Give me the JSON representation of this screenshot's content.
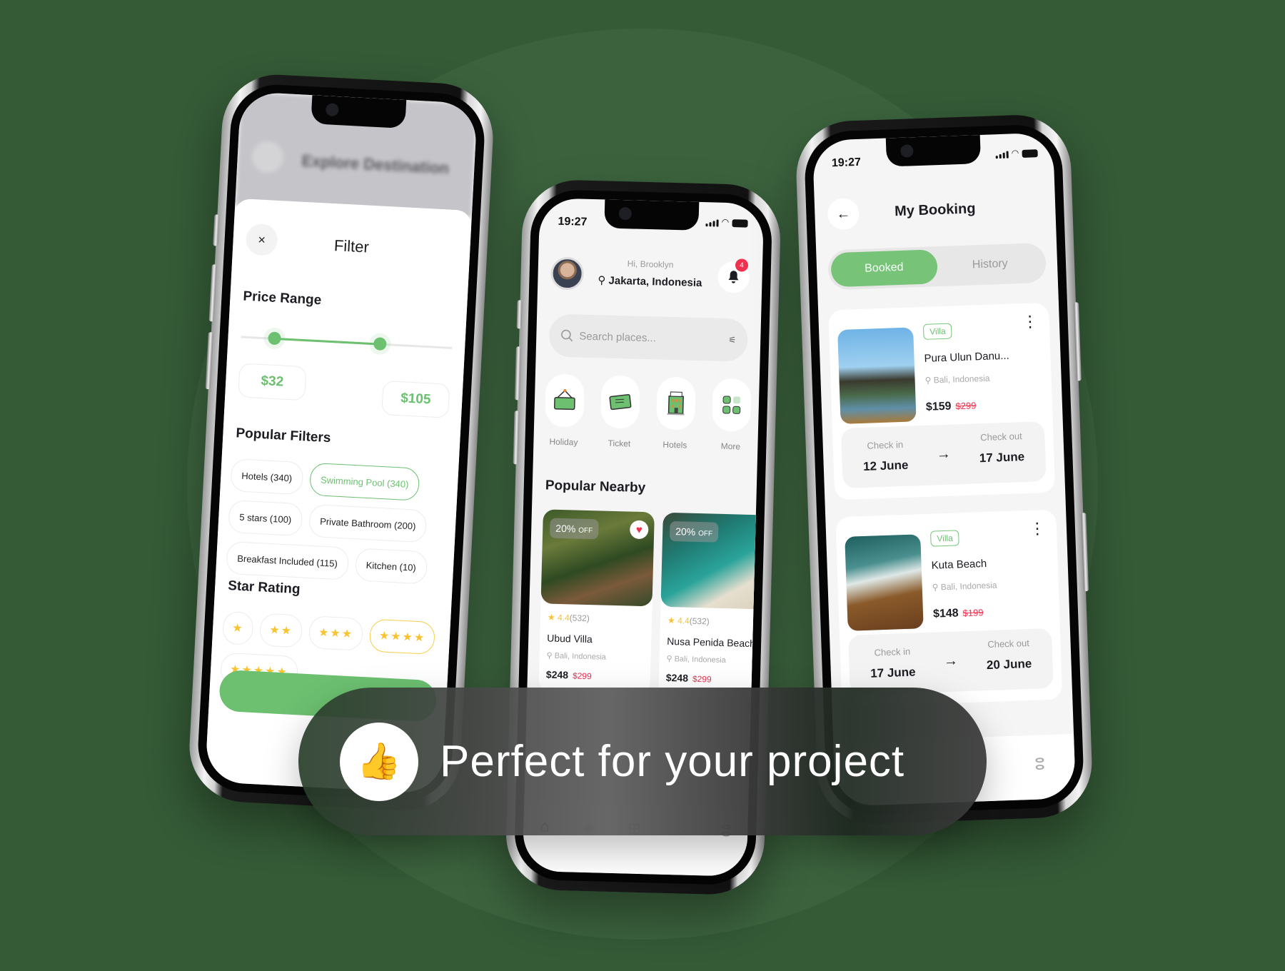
{
  "banner": {
    "icon": "👍",
    "icon_name": "thumbs-up-icon",
    "text": "Perfect for your project"
  },
  "colors": {
    "background": "#345a36",
    "accent_green": "#6cc070",
    "sale_red": "#f0304f",
    "star_yellow": "#f9c22e"
  },
  "filter_screen": {
    "blurred_header_title": "Explore Destination",
    "title": "Filter",
    "close_icon": "×",
    "price_range": {
      "label": "Price Range",
      "min_value": "$32",
      "max_value": "$105",
      "slider_low_fraction": 0.16,
      "slider_high_fraction": 0.66
    },
    "popular_filters": {
      "label": "Popular Filters",
      "items": [
        {
          "label": "Hotels (340)",
          "active": false
        },
        {
          "label": "Swimming Pool (340)",
          "active": true
        },
        {
          "label": "5 stars (100)",
          "active": false
        },
        {
          "label": "Private Bathroom (200)",
          "active": false
        },
        {
          "label": "Breakfast Included (115)",
          "active": false
        },
        {
          "label": "Kitchen (10)",
          "active": false
        }
      ]
    },
    "star_rating": {
      "label": "Star Rating",
      "options": [
        {
          "stars": "★",
          "active": false
        },
        {
          "stars": "★★",
          "active": false
        },
        {
          "stars": "★★★",
          "active": false
        },
        {
          "stars": "★★★★",
          "active": true
        },
        {
          "stars": "★★★★★",
          "active": false
        }
      ]
    }
  },
  "home_screen": {
    "status_time": "19:27",
    "greeting": "Hi, Brooklyn",
    "location": "Jakarta, Indonesia",
    "notification_count": "4",
    "search_placeholder": "Search places...",
    "categories": [
      {
        "label": "Holiday",
        "icon": "holiday-sign-icon"
      },
      {
        "label": "Ticket",
        "icon": "ticket-icon"
      },
      {
        "label": "Hotels",
        "icon": "hotel-building-icon"
      },
      {
        "label": "More",
        "icon": "grid-icon"
      }
    ],
    "section_title": "Popular Nearby",
    "places": [
      {
        "discount": "20%",
        "discount_suffix": "OFF",
        "rating": "4.4",
        "reviews": "(532)",
        "name": "Ubud Villa",
        "location": "Bali, Indonesia",
        "price": "$248",
        "old_price": "$299",
        "favorite": true
      },
      {
        "discount": "20%",
        "discount_suffix": "OFF",
        "rating": "4.4",
        "reviews": "(532)",
        "name": "Nusa Penida Beach",
        "location": "Bali, Indonesia",
        "price": "$248",
        "old_price": "$299",
        "favorite": false
      }
    ],
    "tabbar": [
      "home-icon",
      "explore-icon",
      "ticket-icon",
      "heart-icon",
      "profile-icon"
    ]
  },
  "booking_screen": {
    "status_time": "19:27",
    "title": "My Booking",
    "tabs": [
      {
        "label": "Booked",
        "active": true
      },
      {
        "label": "History",
        "active": false
      }
    ],
    "bookings": [
      {
        "tag": "Villa",
        "name": "Pura Ulun Danu...",
        "location": "Bali, Indonesia",
        "price": "$159",
        "old_price": "$299",
        "check_in_label": "Check in",
        "check_in": "12 June",
        "check_out_label": "Check out",
        "check_out": "17 June"
      },
      {
        "tag": "Villa",
        "name": "Kuta Beach",
        "location": "Bali, Indonesia",
        "price": "$148",
        "old_price": "$199",
        "check_in_label": "Check in",
        "check_in": "17 June",
        "check_out_label": "Check out",
        "check_out": "20 June"
      }
    ]
  }
}
